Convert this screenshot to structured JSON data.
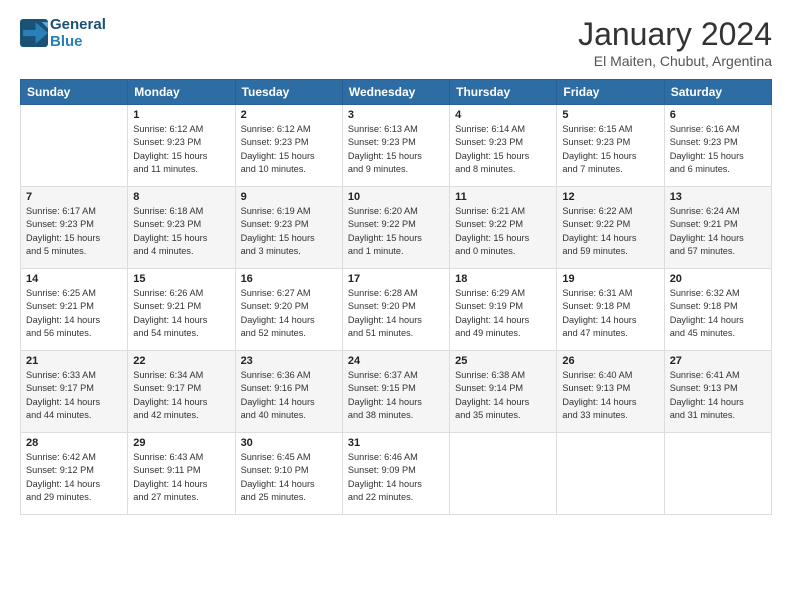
{
  "logo": {
    "line1": "General",
    "line2": "Blue"
  },
  "title": "January 2024",
  "subtitle": "El Maiten, Chubut, Argentina",
  "weekdays": [
    "Sunday",
    "Monday",
    "Tuesday",
    "Wednesday",
    "Thursday",
    "Friday",
    "Saturday"
  ],
  "weeks": [
    [
      {
        "day": "",
        "info": ""
      },
      {
        "day": "1",
        "info": "Sunrise: 6:12 AM\nSunset: 9:23 PM\nDaylight: 15 hours\nand 11 minutes."
      },
      {
        "day": "2",
        "info": "Sunrise: 6:12 AM\nSunset: 9:23 PM\nDaylight: 15 hours\nand 10 minutes."
      },
      {
        "day": "3",
        "info": "Sunrise: 6:13 AM\nSunset: 9:23 PM\nDaylight: 15 hours\nand 9 minutes."
      },
      {
        "day": "4",
        "info": "Sunrise: 6:14 AM\nSunset: 9:23 PM\nDaylight: 15 hours\nand 8 minutes."
      },
      {
        "day": "5",
        "info": "Sunrise: 6:15 AM\nSunset: 9:23 PM\nDaylight: 15 hours\nand 7 minutes."
      },
      {
        "day": "6",
        "info": "Sunrise: 6:16 AM\nSunset: 9:23 PM\nDaylight: 15 hours\nand 6 minutes."
      }
    ],
    [
      {
        "day": "7",
        "info": "Sunrise: 6:17 AM\nSunset: 9:23 PM\nDaylight: 15 hours\nand 5 minutes."
      },
      {
        "day": "8",
        "info": "Sunrise: 6:18 AM\nSunset: 9:23 PM\nDaylight: 15 hours\nand 4 minutes."
      },
      {
        "day": "9",
        "info": "Sunrise: 6:19 AM\nSunset: 9:23 PM\nDaylight: 15 hours\nand 3 minutes."
      },
      {
        "day": "10",
        "info": "Sunrise: 6:20 AM\nSunset: 9:22 PM\nDaylight: 15 hours\nand 1 minute."
      },
      {
        "day": "11",
        "info": "Sunrise: 6:21 AM\nSunset: 9:22 PM\nDaylight: 15 hours\nand 0 minutes."
      },
      {
        "day": "12",
        "info": "Sunrise: 6:22 AM\nSunset: 9:22 PM\nDaylight: 14 hours\nand 59 minutes."
      },
      {
        "day": "13",
        "info": "Sunrise: 6:24 AM\nSunset: 9:21 PM\nDaylight: 14 hours\nand 57 minutes."
      }
    ],
    [
      {
        "day": "14",
        "info": "Sunrise: 6:25 AM\nSunset: 9:21 PM\nDaylight: 14 hours\nand 56 minutes."
      },
      {
        "day": "15",
        "info": "Sunrise: 6:26 AM\nSunset: 9:21 PM\nDaylight: 14 hours\nand 54 minutes."
      },
      {
        "day": "16",
        "info": "Sunrise: 6:27 AM\nSunset: 9:20 PM\nDaylight: 14 hours\nand 52 minutes."
      },
      {
        "day": "17",
        "info": "Sunrise: 6:28 AM\nSunset: 9:20 PM\nDaylight: 14 hours\nand 51 minutes."
      },
      {
        "day": "18",
        "info": "Sunrise: 6:29 AM\nSunset: 9:19 PM\nDaylight: 14 hours\nand 49 minutes."
      },
      {
        "day": "19",
        "info": "Sunrise: 6:31 AM\nSunset: 9:18 PM\nDaylight: 14 hours\nand 47 minutes."
      },
      {
        "day": "20",
        "info": "Sunrise: 6:32 AM\nSunset: 9:18 PM\nDaylight: 14 hours\nand 45 minutes."
      }
    ],
    [
      {
        "day": "21",
        "info": "Sunrise: 6:33 AM\nSunset: 9:17 PM\nDaylight: 14 hours\nand 44 minutes."
      },
      {
        "day": "22",
        "info": "Sunrise: 6:34 AM\nSunset: 9:17 PM\nDaylight: 14 hours\nand 42 minutes."
      },
      {
        "day": "23",
        "info": "Sunrise: 6:36 AM\nSunset: 9:16 PM\nDaylight: 14 hours\nand 40 minutes."
      },
      {
        "day": "24",
        "info": "Sunrise: 6:37 AM\nSunset: 9:15 PM\nDaylight: 14 hours\nand 38 minutes."
      },
      {
        "day": "25",
        "info": "Sunrise: 6:38 AM\nSunset: 9:14 PM\nDaylight: 14 hours\nand 35 minutes."
      },
      {
        "day": "26",
        "info": "Sunrise: 6:40 AM\nSunset: 9:13 PM\nDaylight: 14 hours\nand 33 minutes."
      },
      {
        "day": "27",
        "info": "Sunrise: 6:41 AM\nSunset: 9:13 PM\nDaylight: 14 hours\nand 31 minutes."
      }
    ],
    [
      {
        "day": "28",
        "info": "Sunrise: 6:42 AM\nSunset: 9:12 PM\nDaylight: 14 hours\nand 29 minutes."
      },
      {
        "day": "29",
        "info": "Sunrise: 6:43 AM\nSunset: 9:11 PM\nDaylight: 14 hours\nand 27 minutes."
      },
      {
        "day": "30",
        "info": "Sunrise: 6:45 AM\nSunset: 9:10 PM\nDaylight: 14 hours\nand 25 minutes."
      },
      {
        "day": "31",
        "info": "Sunrise: 6:46 AM\nSunset: 9:09 PM\nDaylight: 14 hours\nand 22 minutes."
      },
      {
        "day": "",
        "info": ""
      },
      {
        "day": "",
        "info": ""
      },
      {
        "day": "",
        "info": ""
      }
    ]
  ]
}
